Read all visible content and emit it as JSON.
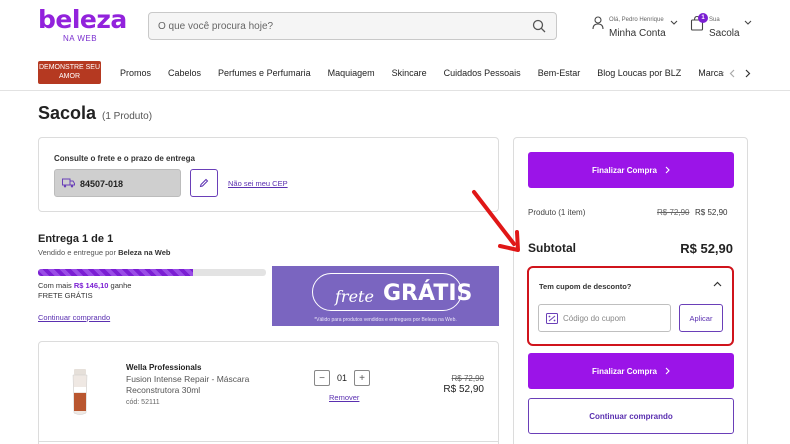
{
  "header": {
    "logo": "beleza",
    "logo_sub": "NA WEB",
    "search_placeholder": "O que você procura hoje?",
    "account_greeting": "Olá, Pedro Henrique",
    "account_label": "Minha Conta",
    "bag_small": "Sua",
    "bag_label": "Sacola",
    "bag_count": "1"
  },
  "nav": {
    "promo_label": "DEMONSTRE SEU AMOR",
    "items": [
      "Promos",
      "Cabelos",
      "Perfumes e Perfumaria",
      "Maquiagem",
      "Skincare",
      "Cuidados Pessoais",
      "Bem-Estar",
      "Blog Loucas por BLZ",
      "Marcas"
    ]
  },
  "page": {
    "title": "Sacola",
    "count": "(1 Produto)"
  },
  "cep": {
    "label": "Consulte o frete e o prazo de entrega",
    "value": "84507-018",
    "link": "Não sei meu CEP"
  },
  "delivery": {
    "title": "Entrega 1 de 1",
    "sub_prefix": "Vendido e entregue por ",
    "sub_seller": "Beleza na Web",
    "progress": 0.68,
    "free_prefix": "Com mais ",
    "free_amount": "R$ 146,10",
    "free_suffix": " ganhe",
    "free_line2": "FRETE GRÁTIS",
    "continue_link": "Continuar comprando",
    "banner_frete": "frete",
    "banner_gratis": "GRÁTIS",
    "banner_note": "*Válido para produtos vendidos e entregues por Beleza na Web."
  },
  "product": {
    "brand": "Wella Professionals",
    "name": "Fusion Intense Repair - Máscara Reconstrutora 30ml",
    "code": "cód: 52111",
    "qty": "01",
    "minus": "−",
    "plus": "+",
    "remove": "Remover",
    "old_price": "R$ 72,90",
    "price": "R$ 52,90"
  },
  "summary": {
    "checkout_label": "Finalizar Compra",
    "product_label": "Produto (1 item)",
    "old_price": "R$ 72,90",
    "new_price": "R$ 52,90",
    "subtotal_label": "Subtotal",
    "subtotal_value": "R$ 52,90",
    "coupon_title": "Tem cupom de desconto?",
    "coupon_placeholder": "Código do cupom",
    "apply_label": "Aplicar",
    "checkout_label_2": "Finalizar Compra",
    "continue_label": "Continuar comprando"
  },
  "colors": {
    "brand": "#9222dc",
    "primary_button": "#9b14e8",
    "highlight": "#d0141c",
    "promo": "#b53921"
  }
}
